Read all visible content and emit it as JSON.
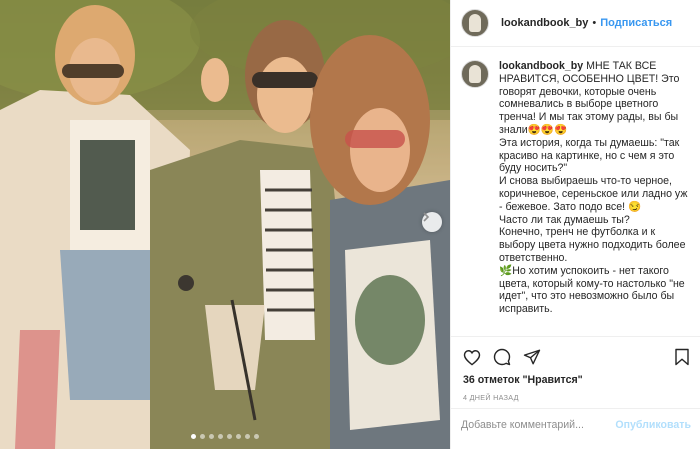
{
  "header": {
    "username": "lookandbook_by",
    "separator": "•",
    "follow_label": "Подписаться"
  },
  "caption": {
    "username": "lookandbook_by",
    "text": " МНЕ ТАК ВСЕ НРАВИТСЯ, ОСОБЕННО ЦВЕТ! Это говорят девочки, которые очень сомневались в выборе цветного тренча! И мы так этому рады, вы бы знали😍😍😍\nЭта история, когда ты думаешь: \"так красиво на картинке, но с чем я это буду носить?\"\nИ снова выбираешь что-то черное, коричневое, сереньское или ладно уж - бежевое. Зато подо все! 😏\nЧасто ли так думаешь ты?\nКонечно, тренч не футболка и к выбору цвета нужно подходить более ответственно.\n🌿Но хотим успокоить - нет такого цвета, который кому-то настолько \"не идет\", что это невозможно было бы исправить."
  },
  "actions": {
    "like_icon": "heart-icon",
    "comment_icon": "comment-bubble-icon",
    "share_icon": "paper-plane-icon",
    "save_icon": "bookmark-icon"
  },
  "likes_text": "36 отметок \"Нравится\"",
  "time_text": "4 ДНЕЙ НАЗАД",
  "comment": {
    "placeholder": "Добавьте комментарий...",
    "post_label": "Опубликовать"
  },
  "carousel": {
    "current": 1,
    "total": 8,
    "next_icon": "chevron-right-icon"
  },
  "colors": {
    "link": "#3897f0",
    "post_disabled": "#b2dffc",
    "muted": "#8e8e8e",
    "border": "#efefef"
  }
}
